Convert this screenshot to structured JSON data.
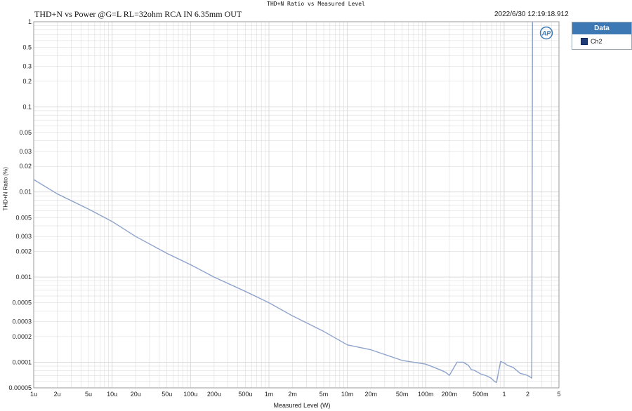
{
  "window_title": "THD+N Ratio vs Measured Level",
  "graph_title": "THD+N vs Power @G=L RL=32ohm RCA IN 6.35mm OUT",
  "timestamp": "2022/6/30 12:19:18.912",
  "legend": {
    "header": "Data",
    "items": [
      {
        "label": "Ch2",
        "color": "#1e3c78"
      }
    ]
  },
  "colors": {
    "trace": "#8ea3cc",
    "grid": "#d6d6d6",
    "legend_header": "#3c78b4",
    "logo": "#3c78b4"
  },
  "chart_data": {
    "type": "line",
    "xlabel": "Measured Level (W)",
    "ylabel": "THD+N Ratio (%)",
    "x_scale": "log",
    "y_scale": "log",
    "xlim": [
      1e-06,
      5
    ],
    "ylim": [
      5e-05,
      1
    ],
    "grid": true,
    "legend_placement": "right",
    "x_ticks": [
      {
        "v": 1e-06,
        "label": "1u"
      },
      {
        "v": 2e-06,
        "label": "2u"
      },
      {
        "v": 5e-06,
        "label": "5u"
      },
      {
        "v": 1e-05,
        "label": "10u"
      },
      {
        "v": 2e-05,
        "label": "20u"
      },
      {
        "v": 5e-05,
        "label": "50u"
      },
      {
        "v": 0.0001,
        "label": "100u"
      },
      {
        "v": 0.0002,
        "label": "200u"
      },
      {
        "v": 0.0005,
        "label": "500u"
      },
      {
        "v": 0.001,
        "label": "1m"
      },
      {
        "v": 0.002,
        "label": "2m"
      },
      {
        "v": 0.005,
        "label": "5m"
      },
      {
        "v": 0.01,
        "label": "10m"
      },
      {
        "v": 0.02,
        "label": "20m"
      },
      {
        "v": 0.05,
        "label": "50m"
      },
      {
        "v": 0.1,
        "label": "100m"
      },
      {
        "v": 0.2,
        "label": "200m"
      },
      {
        "v": 0.5,
        "label": "500m"
      },
      {
        "v": 1,
        "label": "1"
      },
      {
        "v": 2,
        "label": "2"
      },
      {
        "v": 5,
        "label": "5"
      }
    ],
    "y_ticks": [
      {
        "v": 1,
        "label": "1"
      },
      {
        "v": 0.5,
        "label": "0.5"
      },
      {
        "v": 0.3,
        "label": "0.3"
      },
      {
        "v": 0.2,
        "label": "0.2"
      },
      {
        "v": 0.1,
        "label": "0.1"
      },
      {
        "v": 0.05,
        "label": "0.05"
      },
      {
        "v": 0.03,
        "label": "0.03"
      },
      {
        "v": 0.02,
        "label": "0.02"
      },
      {
        "v": 0.01,
        "label": "0.01"
      },
      {
        "v": 0.005,
        "label": "0.005"
      },
      {
        "v": 0.003,
        "label": "0.003"
      },
      {
        "v": 0.002,
        "label": "0.002"
      },
      {
        "v": 0.001,
        "label": "0.001"
      },
      {
        "v": 0.0005,
        "label": "0.0005"
      },
      {
        "v": 0.0003,
        "label": "0.0003"
      },
      {
        "v": 0.0002,
        "label": "0.0002"
      },
      {
        "v": 0.0001,
        "label": "0.0001"
      },
      {
        "v": 5e-05,
        "label": "0.00005"
      }
    ],
    "series": [
      {
        "name": "Ch2",
        "x": [
          1e-06,
          2e-06,
          5e-06,
          1e-05,
          2e-05,
          5e-05,
          0.0001,
          0.0002,
          0.0005,
          0.001,
          0.002,
          0.005,
          0.01,
          0.02,
          0.05,
          0.1,
          0.15,
          0.18,
          0.2,
          0.25,
          0.3,
          0.35,
          0.38,
          0.42,
          0.5,
          0.6,
          0.68,
          0.76,
          0.8,
          0.9,
          1.0,
          1.1,
          1.3,
          1.6,
          1.9,
          2.1,
          2.25,
          2.3
        ],
        "y": [
          0.014,
          0.0095,
          0.0063,
          0.0045,
          0.003,
          0.0019,
          0.0014,
          0.001,
          0.00068,
          0.0005,
          0.00035,
          0.00023,
          0.00016,
          0.00014,
          0.000105,
          9.5e-05,
          8.2e-05,
          7.6e-05,
          7e-05,
          0.0001,
          0.0001,
          9.2e-05,
          8.2e-05,
          8e-05,
          7.3e-05,
          6.9e-05,
          6.5e-05,
          5.9e-05,
          5.8e-05,
          0.000102,
          9.8e-05,
          9.2e-05,
          8.7e-05,
          7.4e-05,
          7.1e-05,
          6.8e-05,
          6.5e-05,
          1.0
        ]
      }
    ]
  }
}
